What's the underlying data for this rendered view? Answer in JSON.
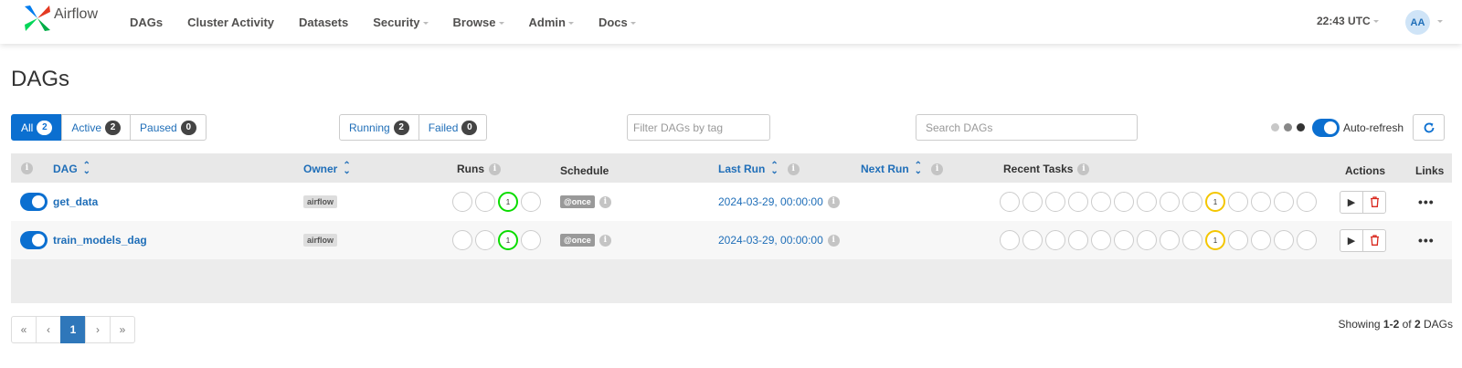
{
  "app": {
    "brand": "Airflow"
  },
  "nav": {
    "items": [
      {
        "label": "DAGs",
        "dropdown": false
      },
      {
        "label": "Cluster Activity",
        "dropdown": false
      },
      {
        "label": "Datasets",
        "dropdown": false
      },
      {
        "label": "Security",
        "dropdown": true
      },
      {
        "label": "Browse",
        "dropdown": true
      },
      {
        "label": "Admin",
        "dropdown": true
      },
      {
        "label": "Docs",
        "dropdown": true
      }
    ],
    "clock": "22:43 UTC",
    "avatar": "AA"
  },
  "page": {
    "title": "DAGs"
  },
  "filters": {
    "status": [
      {
        "label": "All",
        "count": "2"
      },
      {
        "label": "Active",
        "count": "2"
      },
      {
        "label": "Paused",
        "count": "0"
      }
    ],
    "runs": [
      {
        "label": "Running",
        "count": "2"
      },
      {
        "label": "Failed",
        "count": "0"
      }
    ],
    "tag_placeholder": "Filter DAGs by tag",
    "search_placeholder": "Search DAGs",
    "auto_refresh_label": "Auto-refresh"
  },
  "table": {
    "headers": {
      "dag": "DAG",
      "owner": "Owner",
      "runs": "Runs",
      "schedule": "Schedule",
      "last_run": "Last Run",
      "next_run": "Next Run",
      "recent_tasks": "Recent Tasks",
      "actions": "Actions",
      "links": "Links"
    },
    "rows": [
      {
        "dag_id": "get_data",
        "owner": "airflow",
        "runs_running": "1",
        "schedule": "@once",
        "last_run": "2024-03-29, 00:00:00",
        "recent_tasks_queued": "1"
      },
      {
        "dag_id": "train_models_dag",
        "owner": "airflow",
        "runs_running": "1",
        "schedule": "@once",
        "last_run": "2024-03-29, 00:00:00",
        "recent_tasks_queued": "1"
      }
    ]
  },
  "pagination": {
    "first": "«",
    "prev": "‹",
    "current": "1",
    "next": "›",
    "last": "»"
  },
  "footer": {
    "showing_prefix": "Showing",
    "range": "1-2",
    "of": "of",
    "total": "2",
    "suffix": "DAGs"
  },
  "colors": {
    "accent": "#0b6fd0",
    "link": "#1f6eb8",
    "running": "#0adc00",
    "queued": "#f4c600",
    "delete": "#d9281e"
  },
  "icons": {
    "info": "info-icon",
    "sort": "sort-icon",
    "refresh": "refresh-icon",
    "play": "play-icon",
    "delete": "trash-icon",
    "more": "more-icon"
  }
}
